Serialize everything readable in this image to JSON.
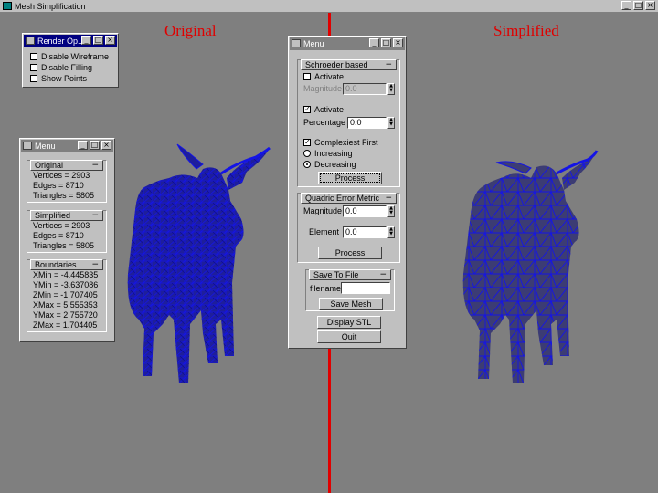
{
  "window": {
    "title": "Mesh Simplification",
    "buttons": [
      "_",
      "□",
      "×"
    ]
  },
  "views": {
    "left_label": "Original",
    "right_label": "Simplified"
  },
  "render_panel": {
    "title": "Render Op...",
    "options": [
      {
        "label": "Disable Wireframe",
        "checked": false
      },
      {
        "label": "Disable Filling",
        "checked": false
      },
      {
        "label": "Show Points",
        "checked": false
      }
    ]
  },
  "info_panel": {
    "title": "Menu",
    "original": {
      "header": "Original",
      "lines": [
        "Vertices = 2903",
        "Edges = 8710",
        "Triangles = 5805"
      ]
    },
    "simplified": {
      "header": "Simplified",
      "lines": [
        "Vertices = 2903",
        "Edges = 8710",
        "Triangles = 5805"
      ]
    },
    "boundaries": {
      "header": "Boundaries",
      "lines": [
        "XMin = -4.445835",
        "YMin = -3.637086",
        "ZMin = -1.707405",
        "XMax = 5.555353",
        "YMax = 2.755720",
        "ZMax = 1.704405"
      ]
    }
  },
  "control_panel": {
    "title": "Menu",
    "schroeder": {
      "header": "Schroeder based",
      "activate_label": "Activate",
      "activate_checked": false,
      "magnitude_label": "Magnitude",
      "magnitude_value": "0.0",
      "activate2_label": "Activate",
      "activate2_checked": true,
      "percentage_label": "Percentage",
      "percentage_value": "0.0",
      "complexiest_label": "Complexiest First",
      "complexiest_checked": true,
      "increasing_label": "Increasing",
      "increasing_selected": false,
      "decreasing_label": "Decreasing",
      "decreasing_selected": true,
      "process_label": "Process"
    },
    "quadric": {
      "header": "Quadric Error Metric",
      "magnitude_label": "Magnitude",
      "magnitude_value": "0.0",
      "element_label": "Element",
      "element_value": "0.0",
      "process_label": "Process"
    },
    "save": {
      "header": "Save To File",
      "filename_label": "filename",
      "filename_value": "",
      "save_label": "Save Mesh"
    },
    "display_stl_label": "Display STL",
    "quit_label": "Quit"
  },
  "colors": {
    "wire": "#1414e6",
    "fill_original": "#1e1e9c",
    "fill_simplified": "#3c3c74",
    "accent": "#e00000",
    "background": "#7f7f7f",
    "panel": "#c0c0c0"
  },
  "icons": {
    "collapse": "minus-icon",
    "checked": "check-icon"
  }
}
